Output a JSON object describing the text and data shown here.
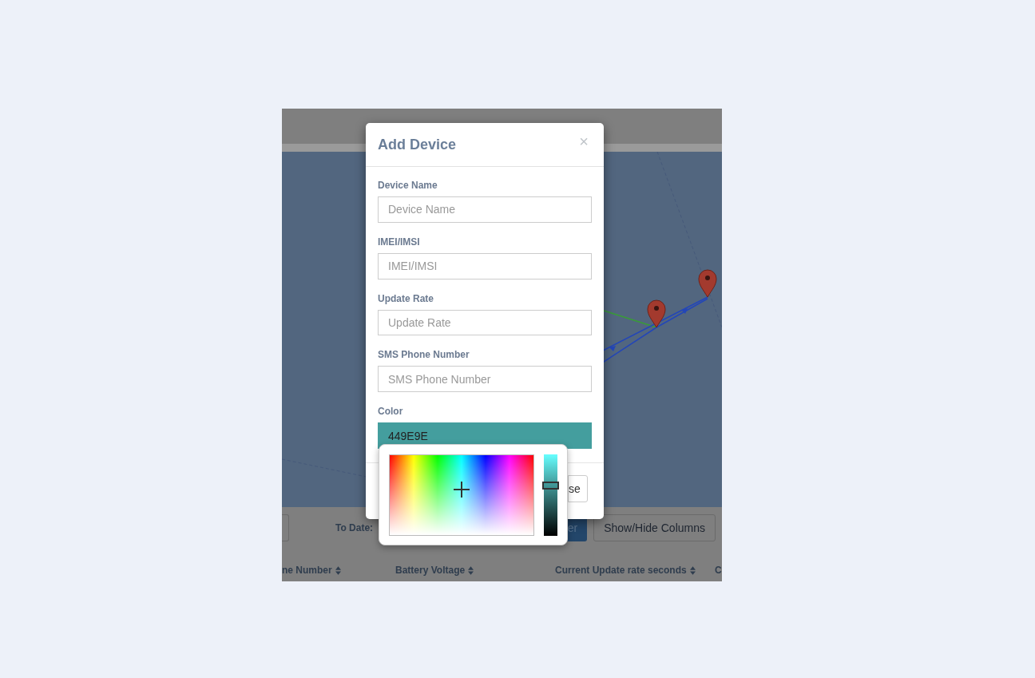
{
  "background_page": {
    "toolbar": {
      "date_label": "To Date:",
      "partial_button": "er",
      "columns_button": "Show/Hide Columns"
    },
    "table": {
      "columns": [
        {
          "label": "ne Number"
        },
        {
          "label": "Battery Voltage"
        },
        {
          "label": "Current Update rate seconds"
        },
        {
          "label": "C"
        }
      ]
    }
  },
  "dialog": {
    "title": "Add Device",
    "close_symbol": "×",
    "fields": [
      {
        "label": "Device Name",
        "placeholder": "Device Name"
      },
      {
        "label": "IMEI/IMSI",
        "placeholder": "IMEI/IMSI"
      },
      {
        "label": "Update Rate",
        "placeholder": "Update Rate"
      },
      {
        "label": "SMS Phone Number",
        "placeholder": "SMS Phone Number"
      }
    ],
    "color": {
      "label": "Color",
      "value": "449E9E"
    },
    "footer_button": "se"
  },
  "color_picker": {
    "brightness": {
      "level": 0.62
    }
  }
}
